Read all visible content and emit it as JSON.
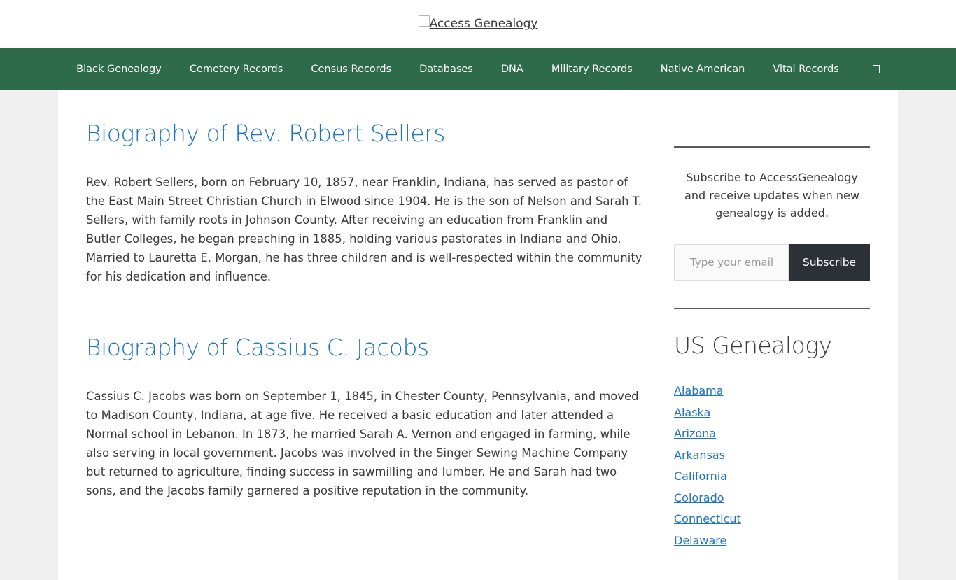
{
  "header": {
    "logo_alt": "Access Genealogy"
  },
  "nav": {
    "items": [
      "Black Genealogy",
      "Cemetery Records",
      "Census Records",
      "Databases",
      "DNA",
      "Military Records",
      "Native American",
      "Vital Records"
    ],
    "search_icon": "search-icon"
  },
  "posts": [
    {
      "title": "Biography of Rev. Robert Sellers",
      "excerpt": "Rev. Robert Sellers, born on February 10, 1857, near Franklin, Indiana, has served as pastor of the East Main Street Christian Church in Elwood since 1904. He is the son of Nelson and Sarah T. Sellers, with family roots in Johnson County. After receiving an education from Franklin and Butler Colleges, he began preaching in 1885, holding various pastorates in Indiana and Ohio. Married to Lauretta E. Morgan, he has three children and is well-respected within the community for his dedication and influence."
    },
    {
      "title": "Biography of Cassius C. Jacobs",
      "excerpt": "Cassius C. Jacobs was born on September 1, 1845, in Chester County, Pennsylvania, and moved to Madison County, Indiana, at age five. He received a basic education and later attended a Normal school in Lebanon. In 1873, he married Sarah A. Vernon and engaged in farming, while also serving in local government. Jacobs was involved in the Singer Sewing Machine Company but returned to agriculture, finding success in sawmilling and lumber. He and Sarah had two sons, and the Jacobs family garnered a positive reputation in the community."
    }
  ],
  "sidebar": {
    "subscribe_text": "Subscribe to AccessGenealogy and receive updates when new genealogy is added.",
    "email_placeholder": "Type your email…",
    "subscribe_button": "Subscribe",
    "widget_title": "US Genealogy",
    "states": [
      "Alabama",
      "Alaska",
      "Arizona",
      "Arkansas",
      "California",
      "Colorado",
      "Connecticut",
      "Delaware"
    ]
  },
  "colors": {
    "nav_bg": "#2e6b4a",
    "link": "#1e73be",
    "button_bg": "#2b3137"
  }
}
